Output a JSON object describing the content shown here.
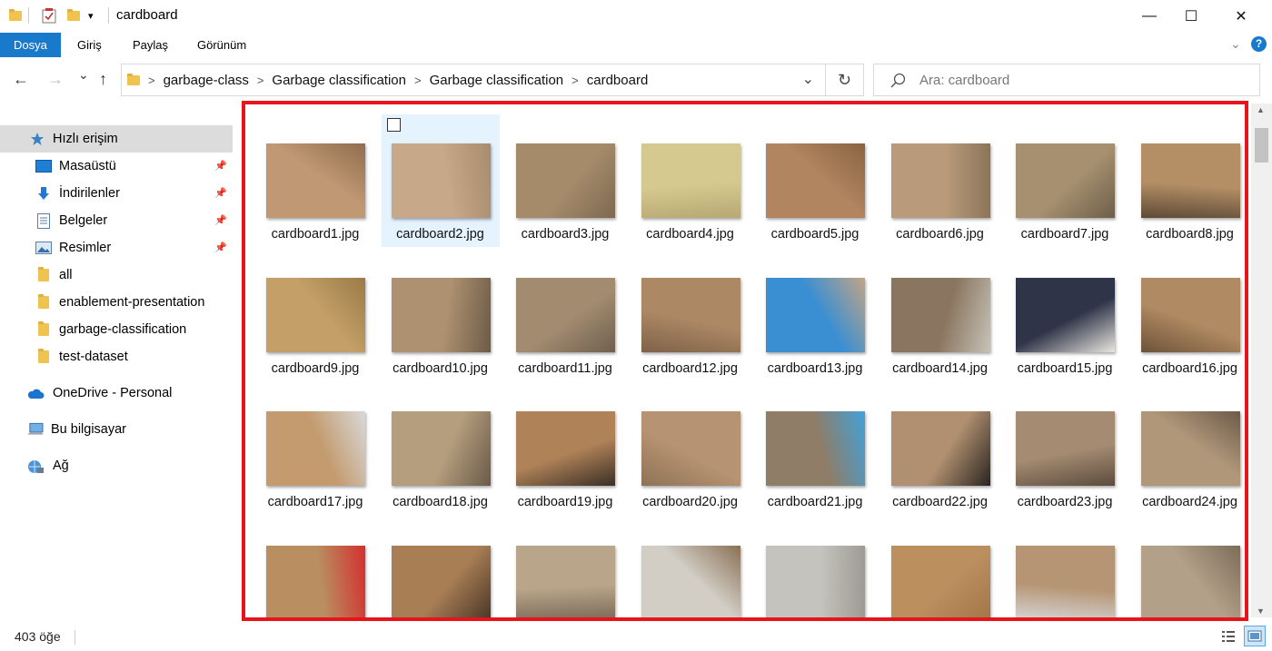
{
  "window": {
    "title": "cardboard",
    "minimize_glyph": "—",
    "maximize_glyph": "☐",
    "close_glyph": "✕"
  },
  "ribbon": {
    "tabs": [
      "Dosya",
      "Giriş",
      "Paylaş",
      "Görünüm"
    ],
    "active_tab": "Dosya",
    "accent": "#1979ca"
  },
  "nav": {
    "back": "←",
    "forward": "→",
    "recent": "⌄",
    "up": "↑",
    "breadcrumbs": [
      "garbage-class",
      "Garbage classification",
      "Garbage classification",
      "cardboard"
    ],
    "search_placeholder": "Ara: cardboard"
  },
  "sidebar": {
    "items": [
      {
        "label": "Hızlı erişim",
        "icon": "star-icon",
        "pinned": false,
        "active": true
      },
      {
        "label": "Masaüstü",
        "icon": "desktop-icon",
        "pinned": true
      },
      {
        "label": "İndirilenler",
        "icon": "download-icon",
        "pinned": true
      },
      {
        "label": "Belgeler",
        "icon": "documents-icon",
        "pinned": true
      },
      {
        "label": "Resimler",
        "icon": "pictures-icon",
        "pinned": true
      },
      {
        "label": "all",
        "icon": "folder-icon",
        "pinned": false
      },
      {
        "label": "enablement-presentation",
        "icon": "folder-icon",
        "pinned": false
      },
      {
        "label": "garbage-classification",
        "icon": "folder-icon",
        "pinned": false
      },
      {
        "label": "test-dataset",
        "icon": "folder-icon",
        "pinned": false
      },
      {
        "label": "OneDrive - Personal",
        "icon": "cloud-icon",
        "pinned": false
      },
      {
        "label": "Bu bilgisayar",
        "icon": "computer-icon",
        "pinned": false
      },
      {
        "label": "Ağ",
        "icon": "network-icon",
        "pinned": false
      }
    ]
  },
  "files": [
    "cardboard1.jpg",
    "cardboard2.jpg",
    "cardboard3.jpg",
    "cardboard4.jpg",
    "cardboard5.jpg",
    "cardboard6.jpg",
    "cardboard7.jpg",
    "cardboard8.jpg",
    "cardboard9.jpg",
    "cardboard10.jpg",
    "cardboard11.jpg",
    "cardboard12.jpg",
    "cardboard13.jpg",
    "cardboard14.jpg",
    "cardboard15.jpg",
    "cardboard16.jpg",
    "cardboard17.jpg",
    "cardboard18.jpg",
    "cardboard19.jpg",
    "cardboard20.jpg",
    "cardboard21.jpg",
    "cardboard22.jpg",
    "cardboard23.jpg",
    "cardboard24.jpg",
    "",
    "",
    "",
    "",
    "",
    "",
    "",
    ""
  ],
  "selected_file": "cardboard2.jpg",
  "thumb_colors": [
    [
      "#c09873",
      "#8f6d4e"
    ],
    [
      "#c7a98a",
      "#a98b6d"
    ],
    [
      "#a68b6b",
      "#7d6950"
    ],
    [
      "#d5c98f",
      "#b8a874"
    ],
    [
      "#b08560",
      "#8a6441"
    ],
    [
      "#b99a7a",
      "#8c7459"
    ],
    [
      "#a6906f",
      "#6e5f4a"
    ],
    [
      "#b48f66",
      "#5e4a36"
    ],
    [
      "#c4a068",
      "#9a7a47"
    ],
    [
      "#ad9170",
      "#6d5b47"
    ],
    [
      "#a38b70",
      "#6e604f"
    ],
    [
      "#ac8865",
      "#7f6248"
    ],
    [
      "#3a8fd2",
      "#c2a585"
    ],
    [
      "#8a7660",
      "#c7c2b8"
    ],
    [
      "#2f3448",
      "#e8e6df"
    ],
    [
      "#b08a62",
      "#6d5339"
    ],
    [
      "#c39b6f",
      "#d9d9d9"
    ],
    [
      "#b59e7e",
      "#6a5a48"
    ],
    [
      "#b08258",
      "#3a2f26"
    ],
    [
      "#b69372",
      "#8e7256"
    ],
    [
      "#8f7d67",
      "#42a1d8"
    ],
    [
      "#b09070",
      "#2a2420"
    ],
    [
      "#a48b72",
      "#5c4c3d"
    ],
    [
      "#b0977a",
      "#6c5b49"
    ],
    [
      "#b98e60",
      "#d32f2f"
    ],
    [
      "#a87e55",
      "#4a3626"
    ],
    [
      "#b9a58a",
      "#7b6a58"
    ],
    [
      "#d2cdc5",
      "#8a7055"
    ],
    [
      "#c5c3bd",
      "#9d9a93"
    ],
    [
      "#bc8f5f",
      "#a27548"
    ],
    [
      "#b69574",
      "#d5d5d5"
    ],
    [
      "#b2a088",
      "#7c6c59"
    ]
  ],
  "status": {
    "item_count": "403 öğe"
  }
}
